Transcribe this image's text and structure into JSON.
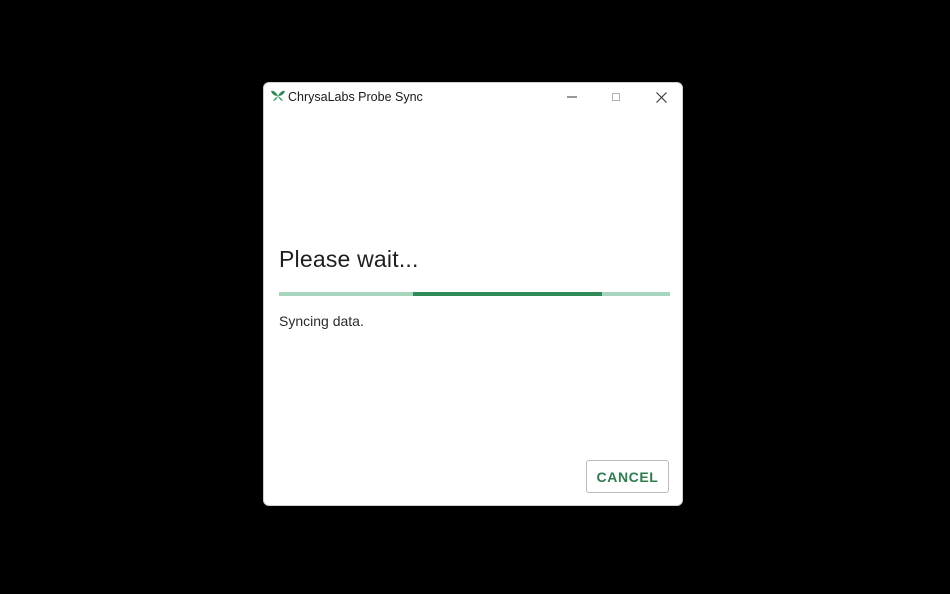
{
  "window": {
    "title": "ChrysaLabs Probe Sync",
    "app_icon": "butterfly-icon",
    "controls": {
      "minimize_icon": "minimize-icon",
      "maximize_icon": "maximize-icon",
      "close_icon": "close-icon"
    }
  },
  "dialog": {
    "heading": "Please wait...",
    "status": "Syncing data.",
    "cancel_label": "CANCEL"
  },
  "progress": {
    "mode": "indeterminate",
    "highlight_start_fraction": 0.343,
    "highlight_end_fraction": 0.826
  },
  "colors": {
    "accent": "#2e8b57",
    "track": "#a8d5bd",
    "button_text": "#2e7d4f",
    "background": "#000000"
  }
}
